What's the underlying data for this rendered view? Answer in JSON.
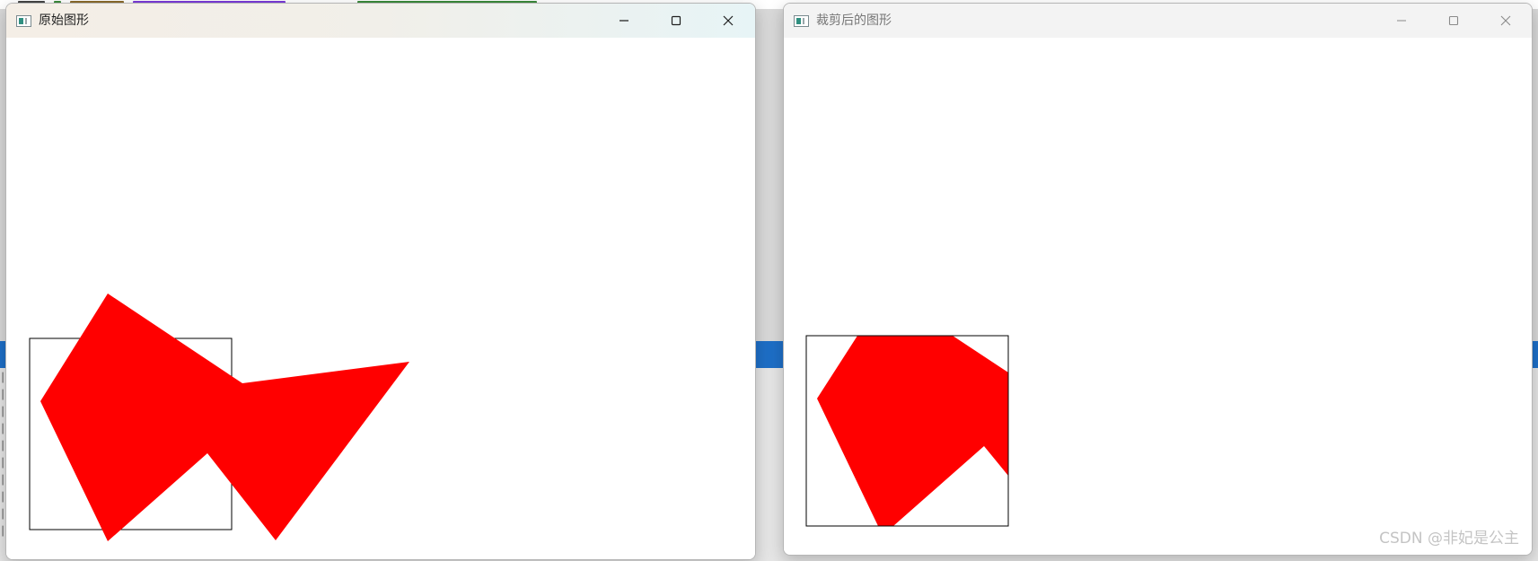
{
  "windows": {
    "original": {
      "title": "原始图形"
    },
    "clipped": {
      "title": "裁剪后的图形"
    }
  },
  "icons": {
    "app": "app-window-icon",
    "minimize": "minimize-icon",
    "maximize": "maximize-icon",
    "close": "close-icon"
  },
  "colors": {
    "polygon_fill": "#ff0000",
    "clip_rect_stroke": "#000000",
    "canvas_bg": "#ffffff"
  },
  "watermark": "CSDN @非妃是公主"
}
